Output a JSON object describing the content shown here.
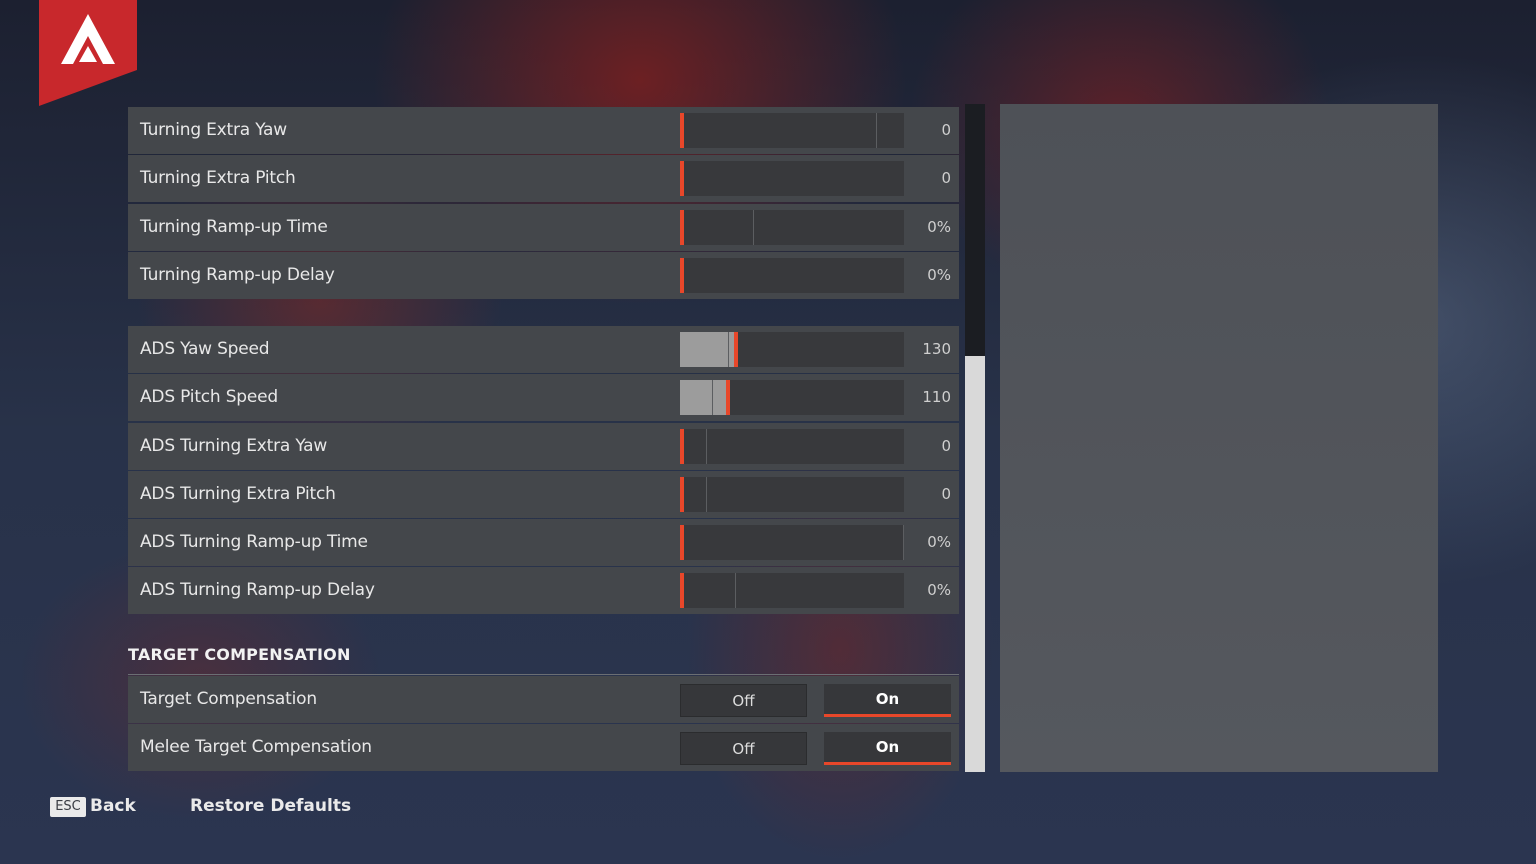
{
  "logo": {
    "icon": "apex-legends-logo",
    "brand_color": "#c8282c"
  },
  "accent_color": "#e8472a",
  "group1": [
    {
      "label": "Turning Extra Yaw",
      "value": "0",
      "fill_pct": 0
    },
    {
      "label": "Turning Extra Pitch",
      "value": "0",
      "fill_pct": 0
    },
    {
      "label": "Turning Ramp-up Time",
      "value": "0%",
      "fill_pct": 0
    },
    {
      "label": "Turning Ramp-up Delay",
      "value": "0%",
      "fill_pct": 0
    }
  ],
  "group2": [
    {
      "label": "ADS Yaw Speed",
      "value": "130",
      "fill_pct": 26
    },
    {
      "label": "ADS Pitch Speed",
      "value": "110",
      "fill_pct": 22
    },
    {
      "label": "ADS Turning Extra Yaw",
      "value": "0",
      "fill_pct": 0
    },
    {
      "label": "ADS Turning Extra Pitch",
      "value": "0",
      "fill_pct": 0
    },
    {
      "label": "ADS Turning Ramp-up Time",
      "value": "0%",
      "fill_pct": 0
    },
    {
      "label": "ADS Turning Ramp-up Delay",
      "value": "0%",
      "fill_pct": 0
    }
  ],
  "target_section": {
    "title": "TARGET COMPENSATION",
    "rows": [
      {
        "label": "Target Compensation",
        "off_label": "Off",
        "on_label": "On",
        "selected": "On"
      },
      {
        "label": "Melee Target Compensation",
        "off_label": "Off",
        "on_label": "On",
        "selected": "On"
      }
    ]
  },
  "footer": {
    "esc_key": "ESC",
    "back_label": "Back",
    "restore_label": "Restore Defaults"
  }
}
